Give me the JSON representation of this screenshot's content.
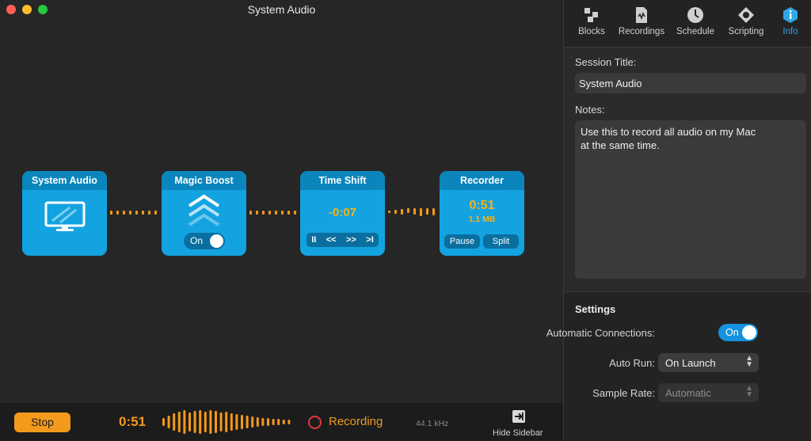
{
  "window": {
    "title": "System Audio"
  },
  "blocks": [
    {
      "title": "System Audio",
      "icon": "monitor-icon"
    },
    {
      "title": "Magic Boost",
      "icon": "chevrons-up-icon",
      "toggle_label": "On"
    },
    {
      "title": "Time Shift",
      "time": "-0:07",
      "controls": [
        "II",
        "<<",
        ">>",
        ">I"
      ]
    },
    {
      "title": "Recorder",
      "time": "0:51",
      "size": "1.1 MB",
      "pause_label": "Pause",
      "split_label": "Split"
    }
  ],
  "bottombar": {
    "stop_label": "Stop",
    "elapsed": "0:51",
    "status": "Recording",
    "sample_rate": "44.1 kHz",
    "hide_sidebar_label": "Hide Sidebar"
  },
  "sidebar": {
    "tabs": [
      {
        "label": "Blocks",
        "icon": "blocks-icon"
      },
      {
        "label": "Recordings",
        "icon": "recordings-icon"
      },
      {
        "label": "Schedule",
        "icon": "clock-icon"
      },
      {
        "label": "Scripting",
        "icon": "scripting-icon"
      },
      {
        "label": "Info",
        "icon": "info-icon",
        "active": true
      }
    ],
    "session_title_label": "Session Title:",
    "session_title_value": "System Audio",
    "notes_label": "Notes:",
    "notes_value": "Use this to record all audio on my Mac\nat the same time.",
    "settings": {
      "heading": "Settings",
      "automatic_connections_label": "Automatic Connections:",
      "automatic_connections_value": "On",
      "auto_run_label": "Auto Run:",
      "auto_run_value": "On Launch",
      "sample_rate_label": "Sample Rate:",
      "sample_rate_value": "Automatic"
    }
  },
  "colors": {
    "block_blue": "#13a3e0",
    "block_header": "#0a86bd",
    "accent_orange": "#f39a1c",
    "accent_yellow": "#f7b21c",
    "info_blue": "#2ea8e7",
    "record_red": "#e0363a"
  }
}
